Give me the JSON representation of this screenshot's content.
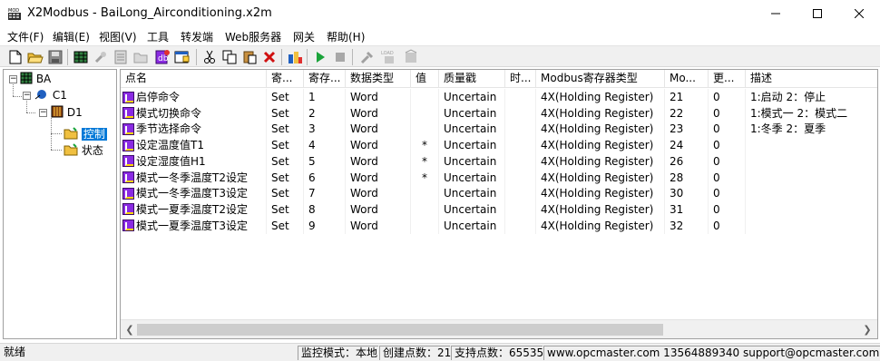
{
  "window": {
    "title": "X2Modbus - BaiLong_Airconditioning.x2m",
    "app_icon_text": "MOD BUS"
  },
  "menu": [
    "文件(F)",
    "编辑(E)",
    "视图(V)",
    "工具",
    "转发端",
    "Web服务器",
    "网关",
    "帮助(H)"
  ],
  "toolbar": {
    "icons": [
      "new-file-icon",
      "open-folder-icon",
      "save-icon",
      "grid-icon",
      "tool-icon",
      "list-icon",
      "folder-open-icon",
      "db-icon",
      "properties-icon",
      "cut-icon",
      "copy-icon",
      "paste-icon",
      "delete-icon",
      "import-icon",
      "start-icon",
      "stop-icon",
      "settings-icon",
      "load-icon",
      "unload-icon"
    ],
    "load_label": "LOAD"
  },
  "tree": {
    "root": "BA",
    "channel": "C1",
    "device": "D1",
    "groups": [
      "控制",
      "状态"
    ],
    "selected": "控制"
  },
  "grid": {
    "columns": [
      "点名",
      "寄...",
      "寄存...",
      "数据类型",
      "值",
      "质量戳",
      "时...",
      "Modbus寄存器类型",
      "Mo...",
      "更...",
      "描述"
    ],
    "rows": [
      [
        "启停命令",
        "Set",
        "1",
        "Word",
        "",
        "Uncertain",
        "",
        "4X(Holding Register)",
        "21",
        "0",
        "1:启动 2：停止"
      ],
      [
        "模式切换命令",
        "Set",
        "2",
        "Word",
        "",
        "Uncertain",
        "",
        "4X(Holding Register)",
        "22",
        "0",
        "1:模式一 2：模式二"
      ],
      [
        "季节选择命令",
        "Set",
        "3",
        "Word",
        "",
        "Uncertain",
        "",
        "4X(Holding Register)",
        "23",
        "0",
        "1:冬季 2：夏季"
      ],
      [
        "设定温度值T1",
        "Set",
        "4",
        "Word",
        "*",
        "Uncertain",
        "",
        "4X(Holding Register)",
        "24",
        "0",
        ""
      ],
      [
        "设定湿度值H1",
        "Set",
        "5",
        "Word",
        "*",
        "Uncertain",
        "",
        "4X(Holding Register)",
        "26",
        "0",
        ""
      ],
      [
        "模式一冬季温度T2设定",
        "Set",
        "6",
        "Word",
        "*",
        "Uncertain",
        "",
        "4X(Holding Register)",
        "28",
        "0",
        ""
      ],
      [
        "模式一冬季温度T3设定",
        "Set",
        "7",
        "Word",
        "",
        "Uncertain",
        "",
        "4X(Holding Register)",
        "30",
        "0",
        ""
      ],
      [
        "模式一夏季温度T2设定",
        "Set",
        "8",
        "Word",
        "",
        "Uncertain",
        "",
        "4X(Holding Register)",
        "31",
        "0",
        ""
      ],
      [
        "模式一夏季温度T3设定",
        "Set",
        "9",
        "Word",
        "",
        "Uncertain",
        "",
        "4X(Holding Register)",
        "32",
        "0",
        ""
      ]
    ]
  },
  "status": {
    "ready": "就绪",
    "mode": "监控模式：本地",
    "created": "创建点数：21",
    "supported": "支持点数：65535",
    "contact": "www.opcmaster.com 13564889340 support@opcmaster.com"
  },
  "colors": {
    "selection": "#0078d7",
    "play": "#1aa33a",
    "delete": "#d01010"
  }
}
